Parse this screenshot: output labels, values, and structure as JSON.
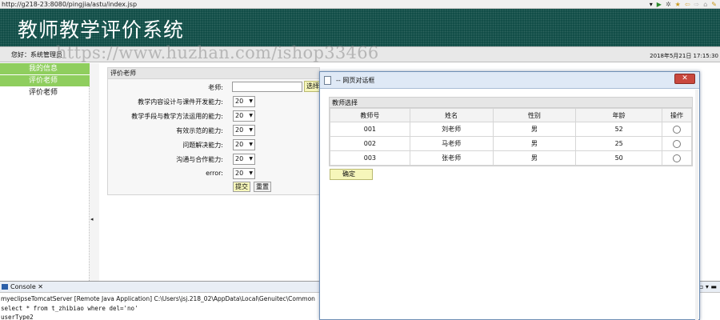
{
  "browser": {
    "url": "http://g218-23:8080/pingjia/astu/index.jsp",
    "toolbar_icons": [
      "▾",
      "▶",
      "✲",
      "★",
      "⇦",
      "⇨",
      "⌂",
      "✎"
    ]
  },
  "header": {
    "title": "教师教学评价系统"
  },
  "greeting": {
    "text": "您好：系统管理员",
    "datetime": "2018年5月21日 17:15:30",
    "watermark": "https://www.huzhan.com/ishop33466"
  },
  "sidebar": {
    "items": [
      {
        "label": "我的信息",
        "style": "green"
      },
      {
        "label": "评价老师",
        "style": "green"
      },
      {
        "label": "评价老师",
        "style": "plain"
      }
    ],
    "collapse_arrow": "◂"
  },
  "form": {
    "title": "评价老师",
    "teacher_label": "老师:",
    "select_button": "选择",
    "criteria": [
      {
        "label": "教学内容设计与课件开发能力:",
        "value": "20"
      },
      {
        "label": "教学手段与教学方法运用的能力:",
        "value": "20"
      },
      {
        "label": "有效示范的能力:",
        "value": "20"
      },
      {
        "label": "问题解决能力:",
        "value": "20"
      },
      {
        "label": "沟通与合作能力:",
        "value": "20"
      },
      {
        "label": "error:",
        "value": "20"
      }
    ],
    "submit_label": "提交",
    "reset_label": "重置"
  },
  "console": {
    "tab_label": "Console ✕",
    "controls": "▫ ▾ ▬",
    "server_line": "myeclipseTomcatServer [Remote Java Application] C:\\Users\\jsj.218_02\\AppData\\Local\\Genuitec\\Common",
    "line1": "select * from t_zhibiao where del='no'",
    "line2": "userType2"
  },
  "dialog": {
    "title": "-- 网页对话框",
    "close_glyph": "✕",
    "panel_title": "教师选择",
    "columns": [
      "教师号",
      "姓名",
      "性别",
      "年龄",
      "操作"
    ],
    "rows": [
      {
        "id": "001",
        "name": "刘老师",
        "gender": "男",
        "age": "52"
      },
      {
        "id": "002",
        "name": "马老师",
        "gender": "男",
        "age": "25"
      },
      {
        "id": "003",
        "name": "张老师",
        "gender": "男",
        "age": "50"
      }
    ],
    "confirm_label": "确定"
  },
  "colors": {
    "header_bg": "#0c4a44",
    "sidebar_green": "#8fce5e",
    "button_yellow": "#f6f6ba",
    "close_red": "#c9483e"
  }
}
